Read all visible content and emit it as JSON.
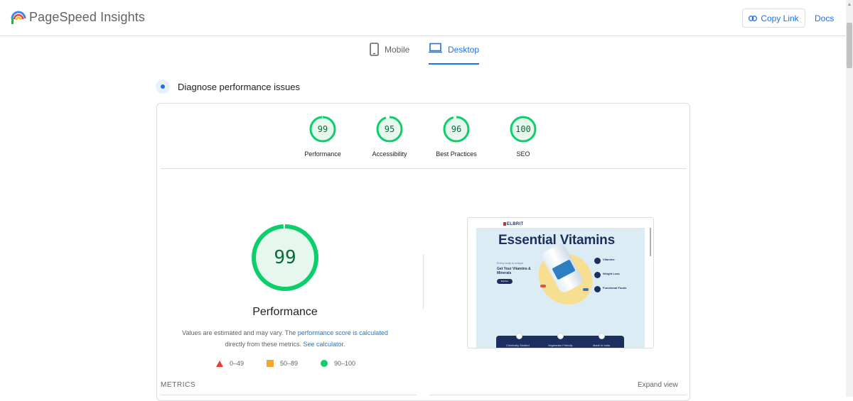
{
  "app": {
    "title": "PageSpeed Insights",
    "copy_link": "Copy Link",
    "docs": "Docs"
  },
  "tabs": [
    {
      "label": "Mobile",
      "active": false
    },
    {
      "label": "Desktop",
      "active": true
    }
  ],
  "section": {
    "title": "Diagnose performance issues"
  },
  "categories": [
    {
      "label": "Performance",
      "score": "99",
      "value": 99
    },
    {
      "label": "Accessibility",
      "score": "95",
      "value": 95
    },
    {
      "label": "Best Practices",
      "score": "96",
      "value": 96
    },
    {
      "label": "SEO",
      "score": "100",
      "value": 100
    }
  ],
  "main_score": {
    "value": "99",
    "label": "Performance",
    "fraction": 0.99
  },
  "note": {
    "text1": "Values are estimated and may vary. The ",
    "link1": "performance score is calculated",
    "text2": " directly from these metrics. ",
    "link2": "See calculator."
  },
  "legend": [
    {
      "range": "0–49",
      "color": "#eb3f32"
    },
    {
      "range": "50–89",
      "color": "#f8a42e"
    },
    {
      "range": "90–100",
      "color": "#0cce6b"
    }
  ],
  "preview": {
    "brand": "ELBRIT",
    "headline": "Essential Vitamins",
    "tagline": "Every body is unique",
    "subhead": "Get Your Vitamins & Minerals",
    "button": "Explore",
    "features": [
      {
        "title": "Vitamins"
      },
      {
        "title": "Weight Loss"
      },
      {
        "title": "Functional Foods"
      }
    ],
    "badges": [
      "Clinnically Studied",
      "Vegetarian Friendly",
      "Made in India"
    ]
  },
  "metrics": {
    "heading": "METRICS",
    "expand": "Expand view"
  },
  "colors": {
    "accent": "#1a73e8",
    "pass": "#0cce6b",
    "pass_fill": "#e6f7ee"
  }
}
